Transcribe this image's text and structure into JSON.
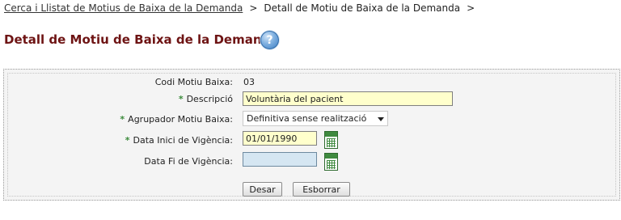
{
  "breadcrumb": {
    "link": "Cerca i Llistat de Motius de Baixa de la Demanda",
    "separator": ">",
    "current": "Detall de Motiu de Baixa de la Demanda"
  },
  "page": {
    "title": "Detall de Motiu de Baixa de la Demanda",
    "help_glyph": "?"
  },
  "form": {
    "required_marker": "*",
    "codi": {
      "label": "Codi Motiu Baixa:",
      "value": "03"
    },
    "descripcio": {
      "label": "Descripció",
      "value": "Voluntària del pacient"
    },
    "agrupador": {
      "label": "Agrupador Motiu Baixa:",
      "selected": "Definitiva sense realització"
    },
    "data_inici": {
      "label": "Data Inici de Vigència:",
      "value": "01/01/1990"
    },
    "data_fi": {
      "label": "Data Fi de Vigència:",
      "value": ""
    }
  },
  "buttons": {
    "save": "Desar",
    "delete": "Esborrar"
  },
  "colors": {
    "title": "#6e1414",
    "required_marker": "#3a8a3a",
    "input_highlight": "#ffffcc",
    "input_empty": "#d5e6f2"
  }
}
